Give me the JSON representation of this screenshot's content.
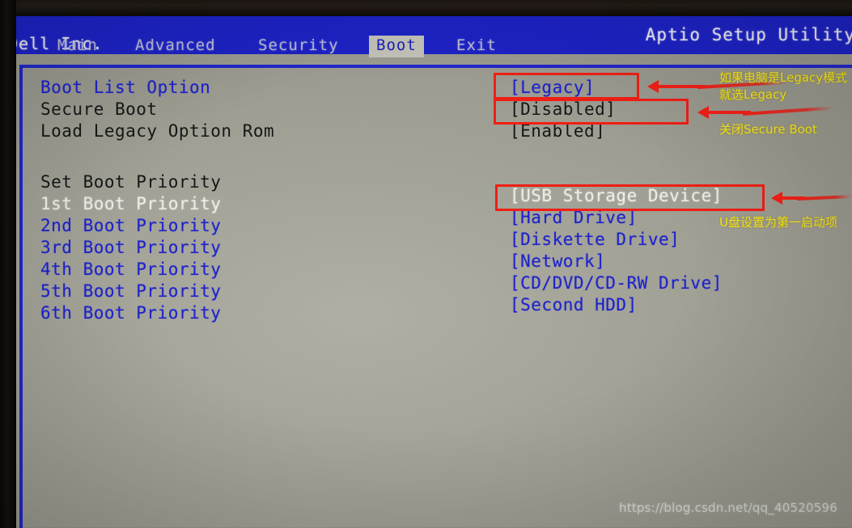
{
  "header": {
    "vendor": "Dell Inc.",
    "title": "Aptio Setup Utility"
  },
  "tabs": [
    {
      "label": "Main",
      "active": false
    },
    {
      "label": "Advanced",
      "active": false
    },
    {
      "label": "Security",
      "active": false
    },
    {
      "label": "Boot",
      "active": true
    },
    {
      "label": "Exit",
      "active": false
    }
  ],
  "settings": [
    {
      "label": "Boot List Option",
      "value": "[Legacy]",
      "label_color": "blue",
      "value_color": "blue"
    },
    {
      "label": "Secure Boot",
      "value": "[Disabled]",
      "label_color": "black",
      "value_color": "black"
    },
    {
      "label": "Load Legacy Option Rom",
      "value": "[Enabled]",
      "label_color": "black",
      "value_color": "black"
    }
  ],
  "boot_priority": {
    "heading": "Set Boot Priority",
    "rows": [
      {
        "label": "1st Boot Priority",
        "value": "[USB Storage Device]",
        "label_color": "white",
        "value_color": "white"
      },
      {
        "label": "2nd Boot Priority",
        "value": "[Hard Drive]",
        "label_color": "blue",
        "value_color": "blue"
      },
      {
        "label": "3rd Boot Priority",
        "value": "[Diskette Drive]",
        "label_color": "blue",
        "value_color": "blue"
      },
      {
        "label": "4th Boot Priority",
        "value": "[Network]",
        "label_color": "blue",
        "value_color": "blue"
      },
      {
        "label": "5th Boot Priority",
        "value": "[CD/DVD/CD-RW Drive]",
        "label_color": "blue",
        "value_color": "blue"
      },
      {
        "label": "6th Boot Priority",
        "value": "[Second HDD]",
        "label_color": "blue",
        "value_color": "blue"
      }
    ]
  },
  "annotations": [
    {
      "line1": "如果电脑是Legacy模式",
      "line2": "就选Legacy"
    },
    {
      "line1": "关闭Secure Boot",
      "line2": ""
    },
    {
      "line1": "U盘设置为第一启动项",
      "line2": ""
    }
  ],
  "watermark": "https://blog.csdn.net/qq_40520596",
  "colors": {
    "header_blue": "#1d22c4",
    "panel_gray": "#a9a99d",
    "text_blue": "#1f23c9",
    "text_black": "#161616",
    "text_white": "#eeeee8",
    "annotation_red": "#f01e14",
    "annotation_yellow": "#f5e61a"
  }
}
